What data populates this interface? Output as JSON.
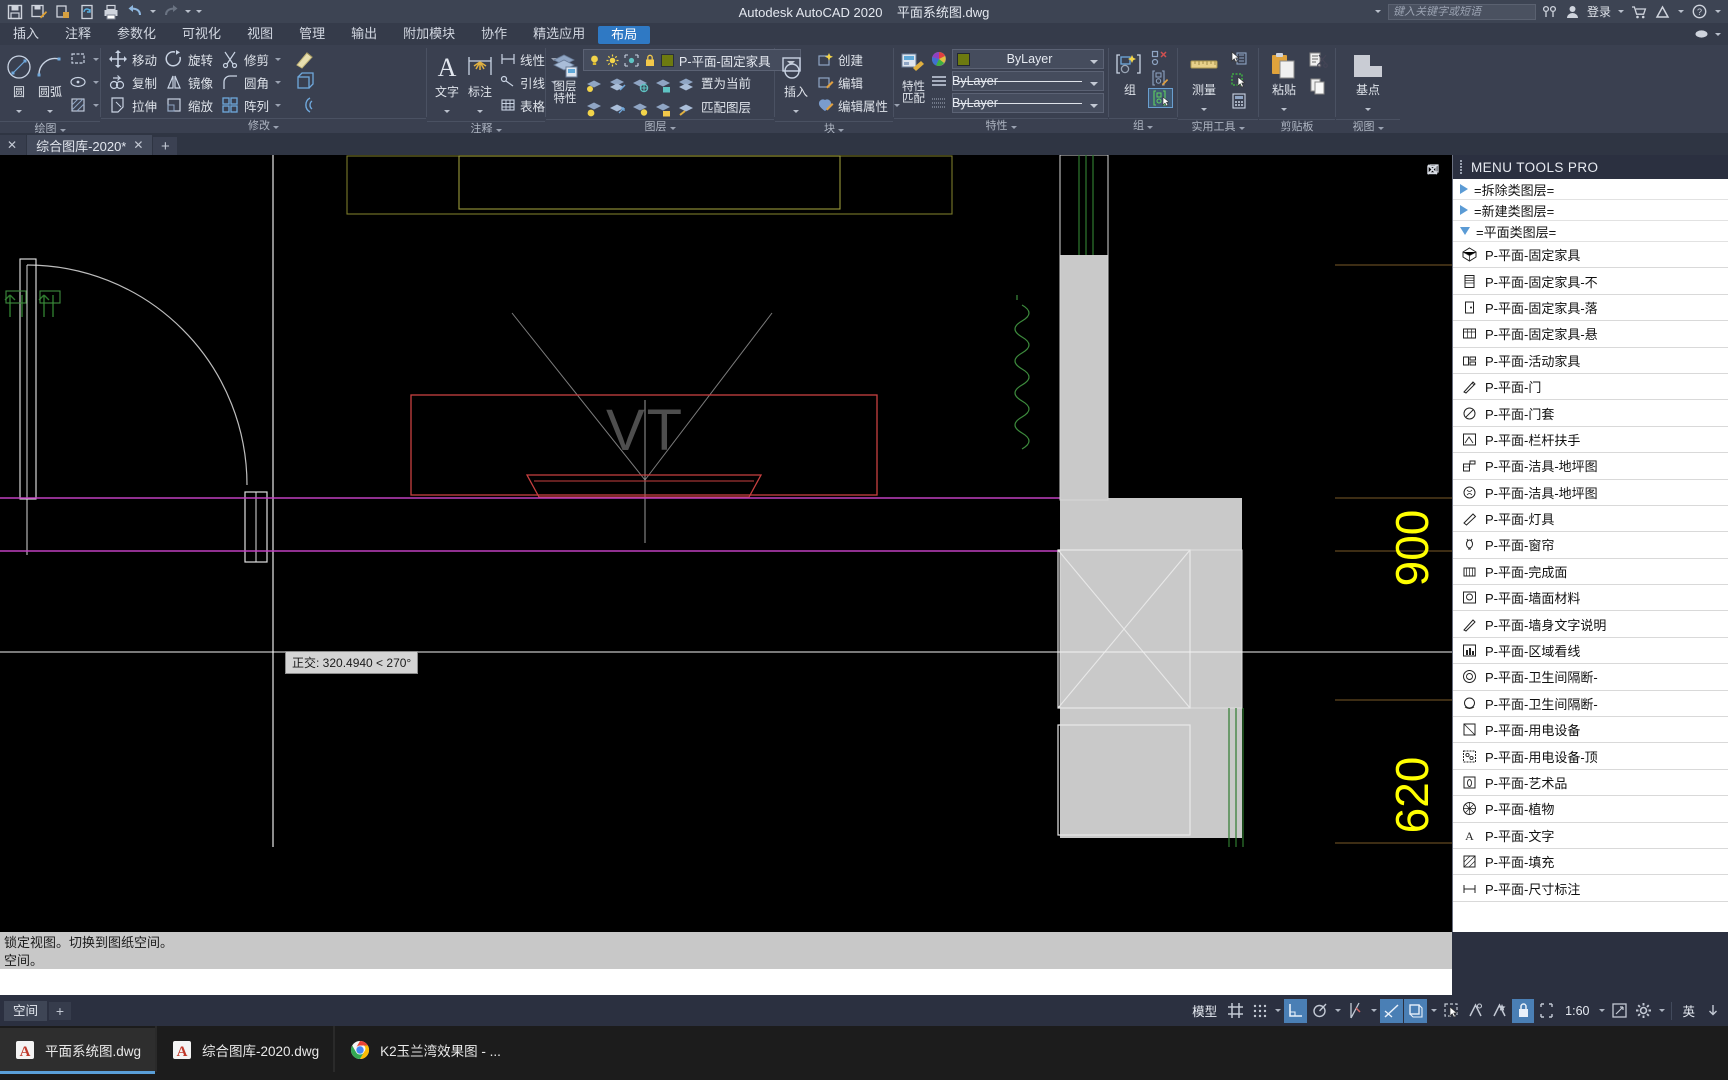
{
  "titlebar": {
    "app_title": "Autodesk AutoCAD 2020",
    "document_title": "平面系统图.dwg",
    "search_placeholder": "键入关键字或短语",
    "signin_label": "登录",
    "quick_access": [
      {
        "name": "save-icon",
        "label": "保存"
      },
      {
        "name": "save-as-icon",
        "label": "另存为"
      },
      {
        "name": "open-icon",
        "label": "打开"
      },
      {
        "name": "sync-icon",
        "label": "同步"
      },
      {
        "name": "plot-icon",
        "label": "打印"
      },
      {
        "name": "undo-icon",
        "label": "放弃"
      },
      {
        "name": "redo-icon",
        "label": "重做"
      },
      {
        "name": "customize-icon",
        "label": "自定义"
      }
    ],
    "window_buttons": [
      "minimize",
      "maximize",
      "close"
    ]
  },
  "menutabs": {
    "items": [
      {
        "label": "插入"
      },
      {
        "label": "注释"
      },
      {
        "label": "参数化"
      },
      {
        "label": "可视化"
      },
      {
        "label": "视图"
      },
      {
        "label": "管理"
      },
      {
        "label": "输出"
      },
      {
        "label": "附加模块"
      },
      {
        "label": "协作"
      },
      {
        "label": "精选应用"
      },
      {
        "label": "布局"
      }
    ],
    "active": "布局"
  },
  "ribbon": {
    "panels": [
      {
        "title": "绘图",
        "big": [
          {
            "label": "圆",
            "icon": "circle-icon"
          },
          {
            "label": "圆弧",
            "icon": "arc-icon"
          }
        ],
        "small": [
          {
            "label": "",
            "icon": "rectangle-icon"
          },
          {
            "label": "",
            "icon": "ellipse-icon"
          },
          {
            "label": "",
            "icon": "hatch-icon"
          }
        ]
      },
      {
        "title": "修改",
        "small": [
          {
            "label": "移动",
            "icon": "move-icon"
          },
          {
            "label": "复制",
            "icon": "copy-icon"
          },
          {
            "label": "拉伸",
            "icon": "stretch-icon"
          },
          {
            "label": "旋转",
            "icon": "rotate-icon"
          },
          {
            "label": "镜像",
            "icon": "mirror-icon"
          },
          {
            "label": "缩放",
            "icon": "scale-icon"
          },
          {
            "label": "修剪",
            "icon": "trim-icon"
          },
          {
            "label": "圆角",
            "icon": "fillet-icon"
          },
          {
            "label": "阵列",
            "icon": "array-icon"
          }
        ],
        "extra_icons": [
          "erase-icon",
          "explode-icon",
          "offset-icon"
        ]
      },
      {
        "title": "注释",
        "big": [
          {
            "label": "文字",
            "icon": "text-icon"
          },
          {
            "label": "标注",
            "icon": "dimension-icon"
          }
        ],
        "small": [
          {
            "label": "线性",
            "icon": "linear-dim-icon"
          },
          {
            "label": "引线",
            "icon": "leader-icon"
          },
          {
            "label": "表格",
            "icon": "table-icon"
          }
        ]
      },
      {
        "title": "图层",
        "big": [
          {
            "label": "图层\n特性",
            "icon": "layer-properties-icon"
          }
        ],
        "layer_combo": {
          "value": "P-平面-固定家具",
          "swatch_color": "#6d7a10",
          "toggles": [
            "lightbulb-icon",
            "sun-icon",
            "frozen-icon",
            "lock-icon"
          ]
        },
        "small": [
          {
            "label": "置为当前",
            "icon": "set-current-icon"
          },
          {
            "label": "匹配图层",
            "icon": "match-layer-icon"
          }
        ]
      },
      {
        "title": "块",
        "big": [
          {
            "label": "插入",
            "icon": "insert-block-icon"
          }
        ],
        "small": [
          {
            "label": "创建",
            "icon": "create-block-icon"
          },
          {
            "label": "编辑",
            "icon": "edit-block-icon"
          },
          {
            "label": "编辑属性",
            "icon": "edit-attributes-icon"
          }
        ]
      },
      {
        "title": "特性",
        "big": [
          {
            "label": "特性\n匹配",
            "icon": "match-properties-icon"
          }
        ],
        "combos": [
          {
            "value": "ByLayer",
            "kind": "color",
            "swatch_color": "#6d7a10"
          },
          {
            "value": "ByLayer",
            "kind": "linetype"
          },
          {
            "value": "ByLayer",
            "kind": "lineweight"
          }
        ]
      },
      {
        "title": "组",
        "big": [
          {
            "label": "组",
            "icon": "group-icon"
          }
        ],
        "small": [
          {
            "label": "",
            "icon": "ungroup-icon"
          },
          {
            "label": "",
            "icon": "group-edit-icon"
          },
          {
            "label": "",
            "icon": "group-selection-icon"
          }
        ]
      },
      {
        "title": "实用工具",
        "big": [
          {
            "label": "测量",
            "icon": "measure-icon"
          }
        ],
        "small": [
          {
            "label": "",
            "icon": "quick-select-icon"
          },
          {
            "label": "",
            "icon": "select-similar-icon"
          },
          {
            "label": "",
            "icon": "calculator-icon"
          }
        ]
      },
      {
        "title": "剪贴板",
        "big": [
          {
            "label": "粘贴",
            "icon": "paste-icon"
          }
        ],
        "small": [
          {
            "label": "",
            "icon": "cut-icon"
          },
          {
            "label": "",
            "icon": "copy-clip-icon"
          }
        ]
      },
      {
        "title": "视图",
        "big": [
          {
            "label": "基点",
            "icon": "base-point-icon"
          }
        ]
      }
    ]
  },
  "filetabs": {
    "tabs": [
      {
        "label": "",
        "modified": true,
        "active": false
      },
      {
        "label": "综合图库-2020*",
        "modified": true,
        "active": true
      }
    ],
    "add_label": "+"
  },
  "canvas": {
    "viewport_buttons": [
      "minimize-icon",
      "restore-icon",
      "close-icon"
    ],
    "tooltip": "正交: 320.4940 < 270°",
    "watermark": "VT",
    "dimension_labels": [
      {
        "text": "900",
        "color": "#ffff00"
      },
      {
        "text": "620",
        "color": "#ffff00"
      }
    ],
    "colors": {
      "furniture_red": "#d14a4a",
      "magenta_line": "#c050c0",
      "green_line": "#3d6b3d",
      "yellow_line": "#7a7a2a",
      "gray_fill": "#c9c9c9",
      "white_line": "#ffffff",
      "brown_line": "#7a5a28"
    }
  },
  "palette": {
    "header": "MENU TOOLS PRO",
    "groups": [
      {
        "label": "=拆除类图层=",
        "expanded": false
      },
      {
        "label": "=新建类图层=",
        "expanded": false
      },
      {
        "label": "=平面类图层=",
        "expanded": true
      }
    ],
    "items": [
      {
        "label": "P-平面-固定家具",
        "icon": "block-3d-icon"
      },
      {
        "label": "P-平面-固定家具-不",
        "icon": "cabinet-icon"
      },
      {
        "label": "P-平面-固定家具-落",
        "icon": "floor-cabinet-icon"
      },
      {
        "label": "P-平面-固定家具-悬",
        "icon": "hanging-cabinet-icon"
      },
      {
        "label": "P-平面-活动家具",
        "icon": "movable-furniture-icon"
      },
      {
        "label": "P-平面-门",
        "icon": "door-icon"
      },
      {
        "label": "P-平面-门套",
        "icon": "door-frame-icon"
      },
      {
        "label": "P-平面-栏杆扶手",
        "icon": "railing-icon"
      },
      {
        "label": "P-平面-洁具-地坪图",
        "icon": "sanitary-icon"
      },
      {
        "label": "P-平面-洁具-地坪图",
        "icon": "sanitary2-icon"
      },
      {
        "label": "P-平面-灯具",
        "icon": "lamp-icon"
      },
      {
        "label": "P-平面-窗帘",
        "icon": "curtain-icon"
      },
      {
        "label": "P-平面-完成面",
        "icon": "finish-surface-icon"
      },
      {
        "label": "P-平面-墙面材料",
        "icon": "wall-material-icon"
      },
      {
        "label": "P-平面-墙身文字说明",
        "icon": "wall-text-icon"
      },
      {
        "label": "P-平面-区域看线",
        "icon": "zone-line-icon"
      },
      {
        "label": "P-平面-卫生间隔断-",
        "icon": "toilet-partition-icon"
      },
      {
        "label": "P-平面-卫生间隔断-",
        "icon": "toilet-partition2-icon"
      },
      {
        "label": "P-平面-用电设备",
        "icon": "electrical-icon"
      },
      {
        "label": "P-平面-用电设备-顶",
        "icon": "electrical-ceiling-icon"
      },
      {
        "label": "P-平面-艺术品",
        "icon": "artwork-icon"
      },
      {
        "label": "P-平面-植物",
        "icon": "plant-icon"
      },
      {
        "label": "P-平面-文字",
        "icon": "text-layer-icon"
      },
      {
        "label": "P-平面-填充",
        "icon": "fill-icon"
      },
      {
        "label": "P-平面-尺寸标注",
        "icon": "dimension-layer-icon"
      }
    ]
  },
  "command": {
    "history_lines": [
      "锁定视图。切换到图纸空间。",
      "空间。"
    ]
  },
  "statusbar": {
    "left_tabs": [
      {
        "label": "空间"
      }
    ],
    "add_label": "+",
    "model_label": "模型",
    "scale_label": "1:60",
    "lang_label": "英",
    "icons": [
      {
        "name": "grid-display-icon",
        "on": false
      },
      {
        "name": "snap-mode-icon",
        "on": false
      },
      {
        "name": "ortho-mode-icon",
        "on": true
      },
      {
        "name": "polar-tracking-icon",
        "on": false
      },
      {
        "name": "object-snap-icon",
        "on": false
      },
      {
        "name": "object-snap-tracking-icon",
        "on": true
      },
      {
        "name": "ucs-icon",
        "on": true
      },
      {
        "name": "selection-cycling-icon",
        "on": false
      },
      {
        "name": "annotation-visibility-icon",
        "on": false
      },
      {
        "name": "autoscale-icon",
        "on": false
      },
      {
        "name": "workspace-lock-icon",
        "on": true
      },
      {
        "name": "isolate-objects-icon",
        "on": false
      },
      {
        "name": "clean-screen-icon",
        "on": false
      },
      {
        "name": "customization-icon",
        "on": false
      }
    ]
  },
  "taskbar": {
    "items": [
      {
        "label": "平面系统图.dwg",
        "icon": "autocad-icon",
        "active": true
      },
      {
        "label": "综合图库-2020.dwg",
        "icon": "autocad-icon",
        "active": false
      },
      {
        "label": "K2玉兰湾效果图 - ...",
        "icon": "chrome-icon",
        "active": false
      }
    ]
  }
}
